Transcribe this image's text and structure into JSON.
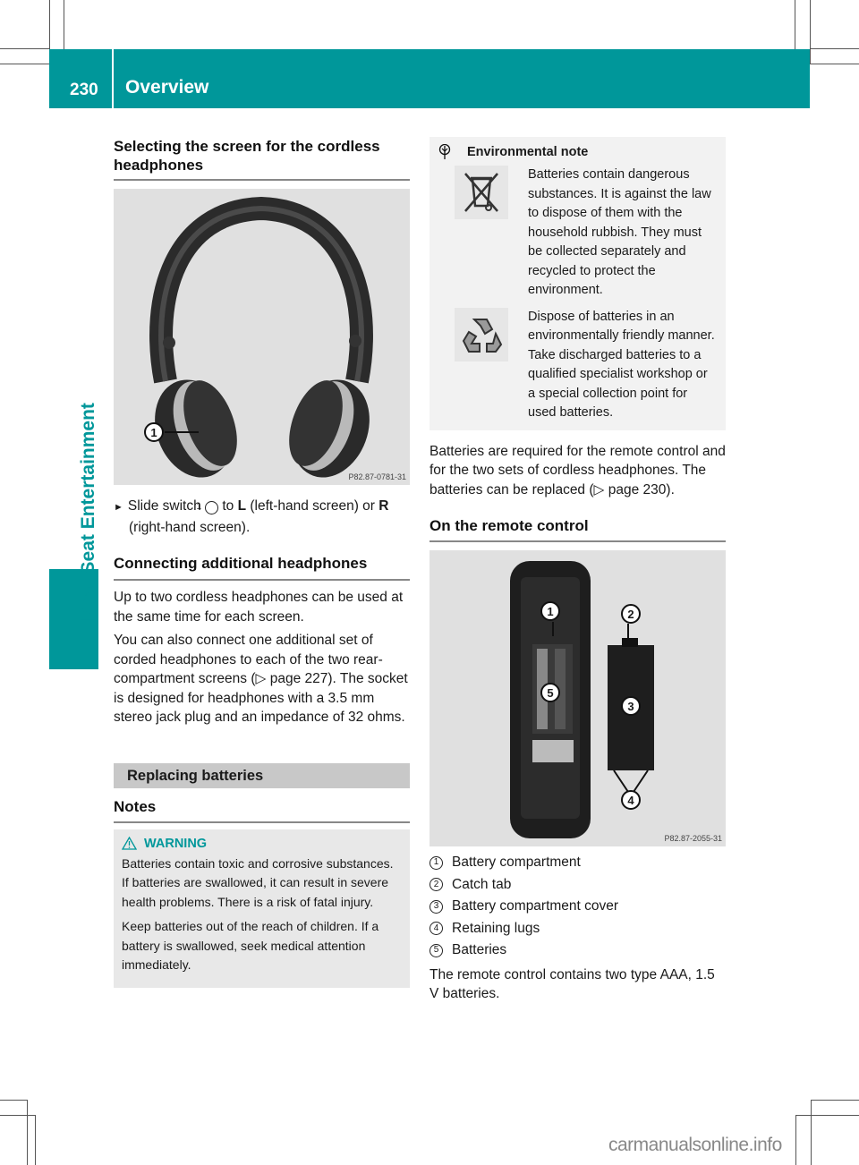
{
  "header": {
    "page_number": "230",
    "title": "Overview",
    "side_label": "Rear Seat Entertainment",
    "accent_color": "#00979a"
  },
  "left": {
    "section1_title": "Selecting the screen for the cordless headphones",
    "fig1_code": "P82.87-0781-31",
    "fig1_callout": "1",
    "instruction": {
      "bullet": "►",
      "text_a": "Slide switch",
      "callout": "1",
      "text_b": "to",
      "bold_l": "L",
      "text_c": "(left-hand screen) or",
      "bold_r": "R",
      "text_d": "(right-hand screen)."
    },
    "section2_title": "Connecting additional headphones",
    "para1": "Up to two cordless headphones can be used at the same time for each screen.",
    "para2_a": "You can also connect one additional set of corded headphones to each of the two rear-compartment screens (",
    "para2_ref": "▷ page 227",
    "para2_b": "). The socket is designed for headphones with a 3.5 mm stereo jack plug and an impedance of 32 ohms.",
    "section3_title": "Replacing batteries",
    "section4_title": "Notes",
    "warning": {
      "title": "WARNING",
      "text1": "Batteries contain toxic and corrosive substances. If batteries are swallowed, it can result in severe health problems. There is a risk of fatal injury.",
      "text2": "Keep batteries out of the reach of children. If a battery is swallowed, seek medical attention immediately."
    }
  },
  "right": {
    "env_note": {
      "title": "Environmental note",
      "text1": "Batteries contain dangerous substances. It is against the law to dispose of them with the household rubbish. They must be collected separately and recycled to protect the environment.",
      "text2": "Dispose of batteries in an environmentally friendly manner. Take discharged batteries to a qualified specialist workshop or a special collection point for used batteries."
    },
    "para1_a": "Batteries are required for the remote control and for the two sets of cordless headphones. The batteries can be replaced (",
    "para1_ref": "▷ page 230",
    "para1_b": ").",
    "section_title": "On the remote control",
    "fig2_code": "P82.87-2055-31",
    "fig2_callouts": [
      "1",
      "2",
      "3",
      "4",
      "5"
    ],
    "legend": [
      {
        "num": "1",
        "label": "Battery compartment"
      },
      {
        "num": "2",
        "label": "Catch tab"
      },
      {
        "num": "3",
        "label": "Battery compartment cover"
      },
      {
        "num": "4",
        "label": "Retaining lugs"
      },
      {
        "num": "5",
        "label": "Batteries"
      }
    ],
    "closing": "The remote control contains two type AAA, 1.5 V batteries."
  },
  "footer": {
    "watermark": "carmanualsonline.info"
  }
}
